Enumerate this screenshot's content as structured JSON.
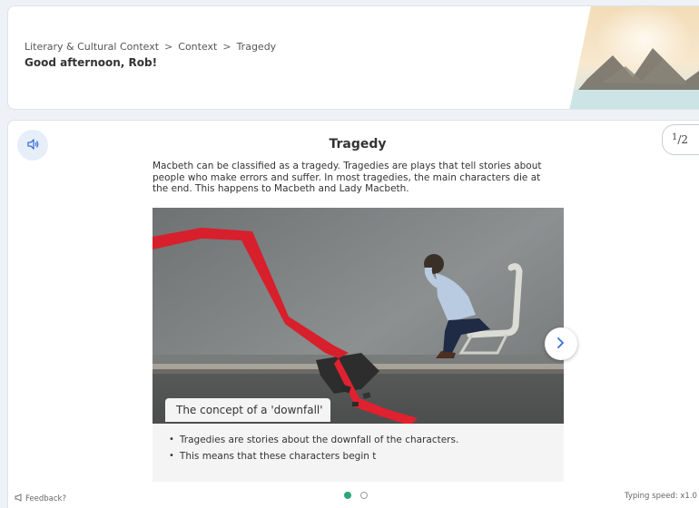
{
  "header": {
    "breadcrumb": [
      "Literary & Cultural Context",
      "Context",
      "Tragedy"
    ],
    "breadcrumb_separator": ">",
    "greeting": "Good afternoon, Rob!"
  },
  "slide": {
    "page_current": "1",
    "page_total": "2",
    "title": "Tragedy",
    "text": "Macbeth can be classified as a tragedy. Tragedies are plays that tell stories about people who make errors and suffer. In most tragedies, the main characters die at the end. This happens to Macbeth and Lady Macbeth.",
    "callout_title": "The concept of a 'downfall'",
    "bullets": [
      "Tragedies are stories about the downfall of the characters.",
      "This means that these characters begin t"
    ]
  },
  "footer": {
    "feedback_label": "Feedback?",
    "typing_speed_label": "Typing speed: x1.0"
  },
  "icons": {
    "audio": "speaker-icon",
    "next": "chevron-right-icon",
    "feedback": "megaphone-icon"
  },
  "colors": {
    "accent_blue": "#3a6fd8",
    "dot_active": "#2aa876",
    "arrow_red": "#e0212f"
  }
}
